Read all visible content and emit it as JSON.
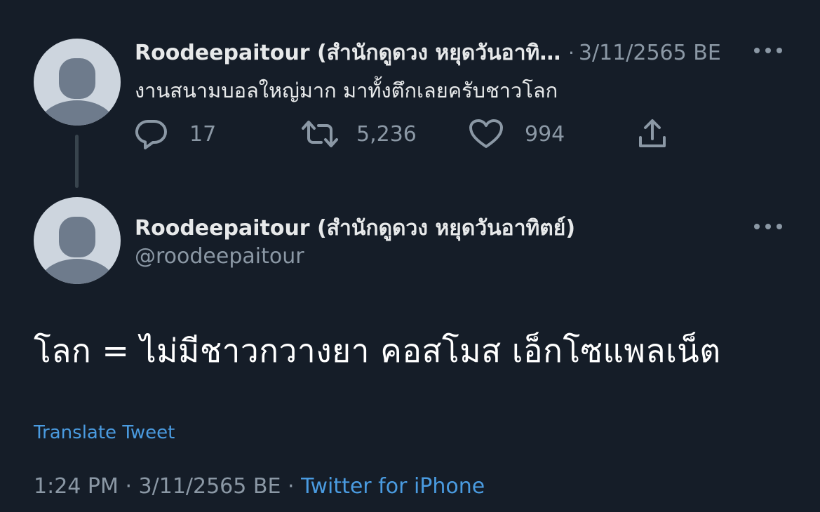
{
  "reply": {
    "display_name": "Roodeepaitour (สำนักดูดวง หยุดวันอาทิตย์)",
    "separator": "·",
    "date": "3/11/2565 BE",
    "text": "งานสนามบอลใหญ่มาก มาทั้งตึกเลยครับชาวโลก",
    "replies_count": "17",
    "retweets_count": "5,236",
    "likes_count": "994"
  },
  "main": {
    "display_name": "Roodeepaitour (สำนักดูดวง หยุดวันอาทิตย์)",
    "handle": "@roodeepaitour",
    "text": "โลก = ไม่มีชาวกวางยา คอสโมส เอ็กโซแพลเน็ต",
    "translate_label": "Translate Tweet",
    "time": "1:24 PM",
    "separator": "·",
    "date": "3/11/2565 BE",
    "source": "Twitter for iPhone"
  },
  "colors": {
    "background": "#151d28",
    "text": "#e7e9ea",
    "muted": "#8b98a5",
    "link": "#4a9be0",
    "avatar": "#cdd5de",
    "avatar_figure": "#6e7b8c"
  },
  "icons": {
    "reply": "speech-bubble-icon",
    "retweet": "retweet-icon",
    "like": "heart-icon",
    "share": "share-icon",
    "more": "more-dots-icon"
  }
}
